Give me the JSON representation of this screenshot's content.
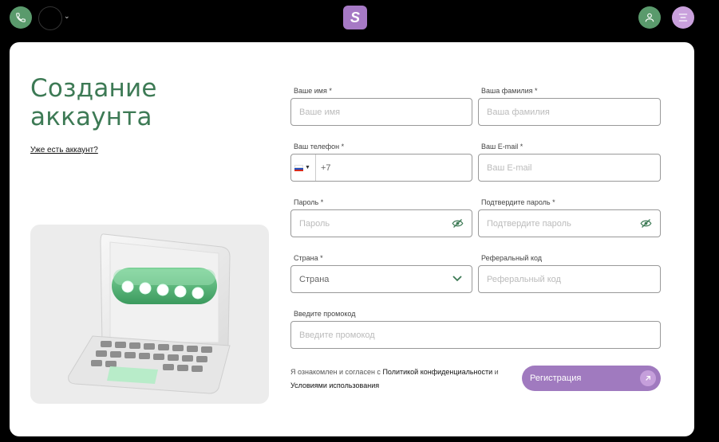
{
  "header": {
    "logo_letter": "S"
  },
  "page": {
    "title_line1": "Создание",
    "title_line2": "аккаунта",
    "login_link": "Уже есть аккаунт?"
  },
  "form": {
    "first_name": {
      "label": "Ваше имя *",
      "placeholder": "Ваше имя"
    },
    "last_name": {
      "label": "Ваша фамилия *",
      "placeholder": "Ваша фамилия"
    },
    "phone": {
      "label": "Ваш телефон *",
      "value": "+7"
    },
    "email": {
      "label": "Ваш E-mail *",
      "placeholder": "Ваш E-mail"
    },
    "password": {
      "label": "Пароль *",
      "placeholder": "Пароль"
    },
    "password_confirm": {
      "label": "Подтвердите пароль *",
      "placeholder": "Подтвердите пароль"
    },
    "country": {
      "label": "Страна *",
      "value": "Страна"
    },
    "referral": {
      "label": "Реферальный код",
      "placeholder": "Реферальный код"
    },
    "promo": {
      "label": "Введите промокод",
      "placeholder": "Введите промокод"
    }
  },
  "consent": {
    "prefix": "Я ознакомлен и согласен с",
    "privacy_link": "Политикой конфиденциальности",
    "and": "и",
    "terms_link": "Условиями использования"
  },
  "register_button": "Регистрация",
  "colors": {
    "green": "#3d7a55",
    "purple": "#a07abf"
  }
}
